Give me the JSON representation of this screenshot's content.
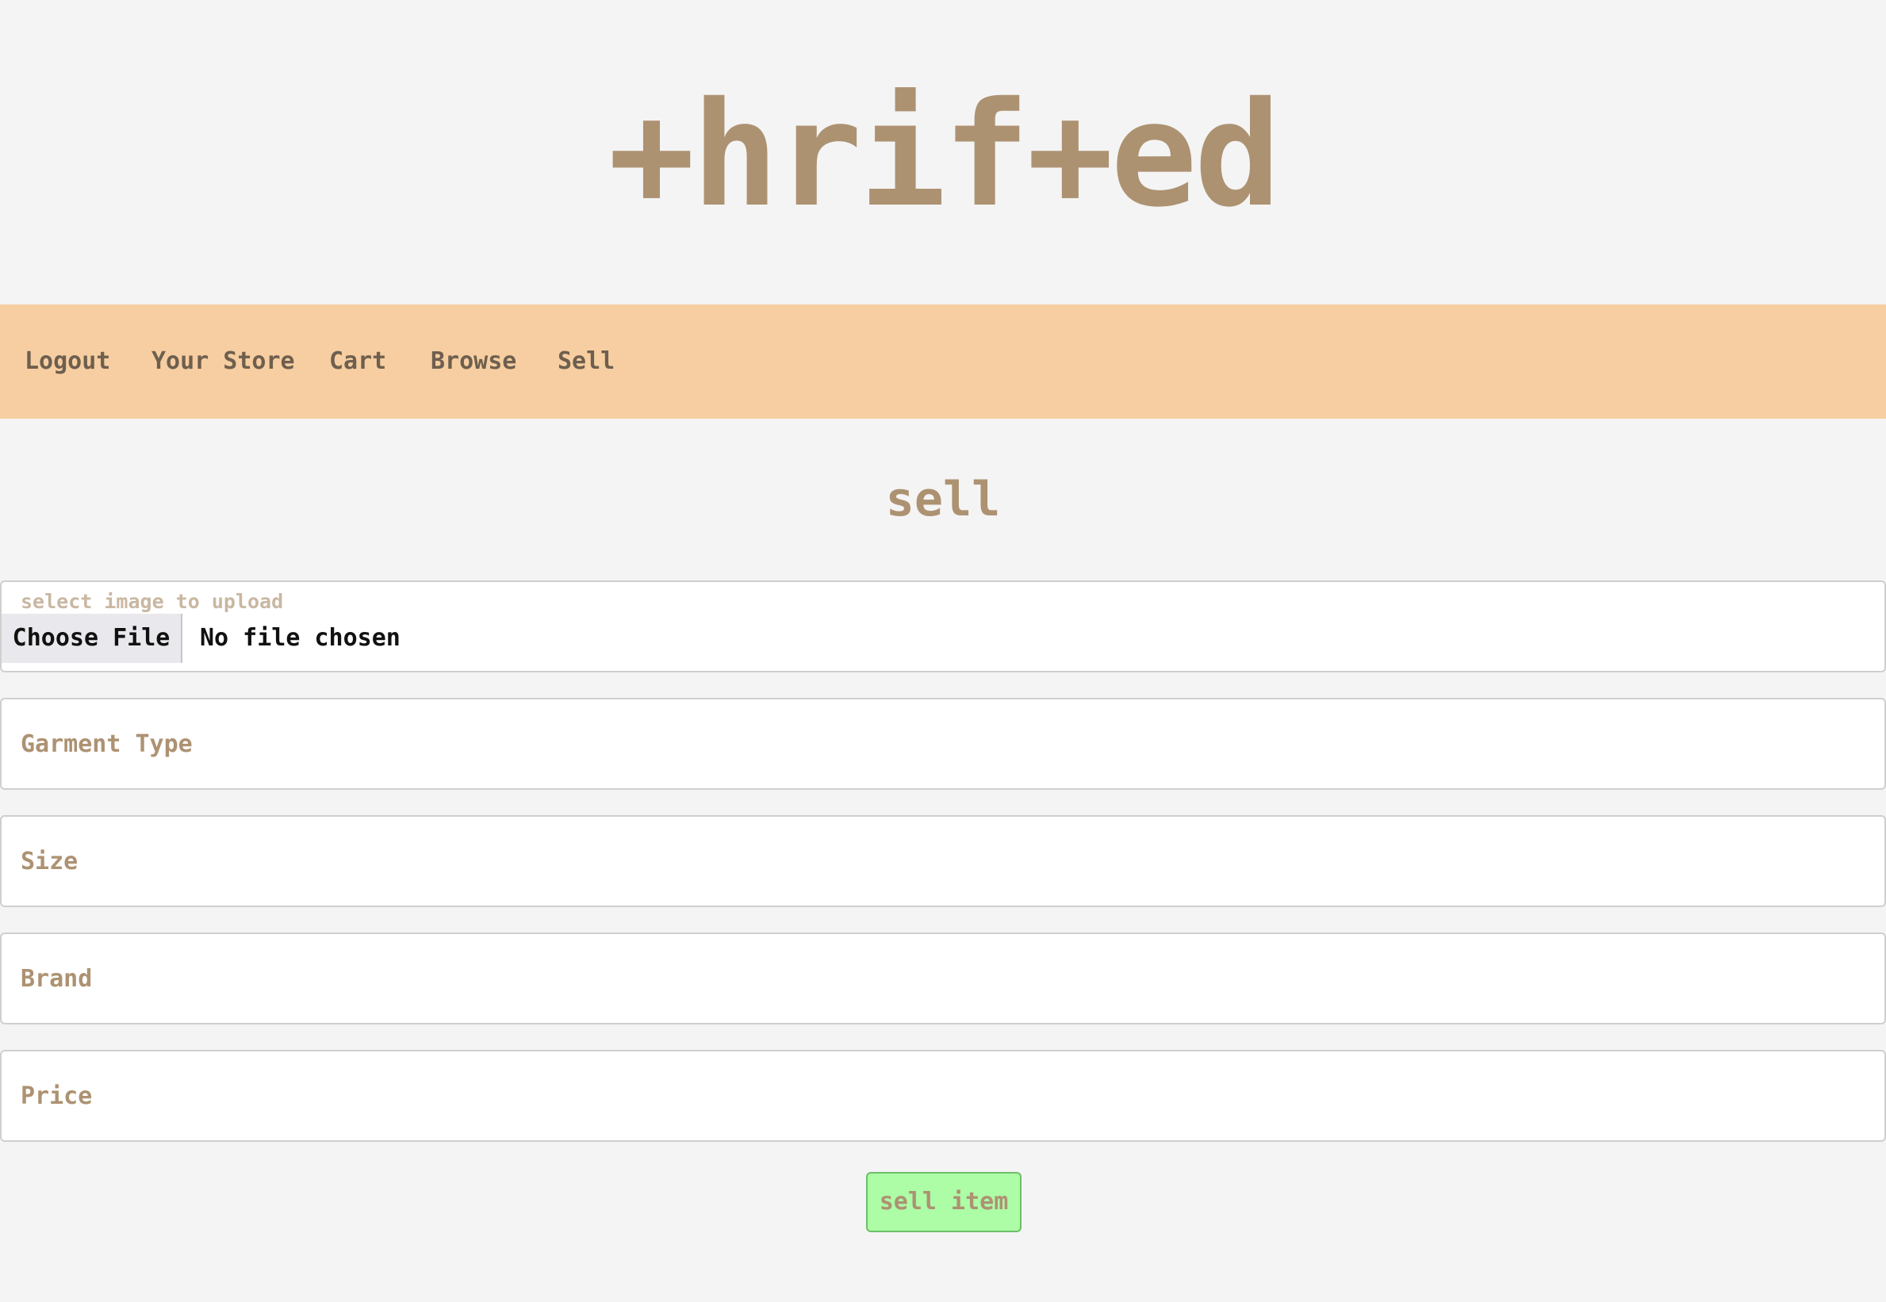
{
  "logo": {
    "text": "+hrif+ed"
  },
  "nav": {
    "items": [
      {
        "label": "Logout"
      },
      {
        "label": "Your Store"
      },
      {
        "label": "Cart"
      },
      {
        "label": "Browse"
      },
      {
        "label": "Sell"
      }
    ]
  },
  "page": {
    "title": "sell"
  },
  "form": {
    "upload": {
      "label": "select image to upload",
      "button_label": "Choose File",
      "status": "No file chosen"
    },
    "garment_type": {
      "placeholder": "Garment Type",
      "value": ""
    },
    "size": {
      "placeholder": "Size",
      "value": ""
    },
    "brand": {
      "placeholder": "Brand",
      "value": ""
    },
    "price": {
      "placeholder": "Price",
      "value": ""
    },
    "submit_label": "sell item"
  },
  "colors": {
    "background": "#f4f4f4",
    "brand": "#ad9272",
    "nav_background": "#f7cea1",
    "nav_text": "#6e5f4e",
    "submit_background": "#adfca6"
  }
}
